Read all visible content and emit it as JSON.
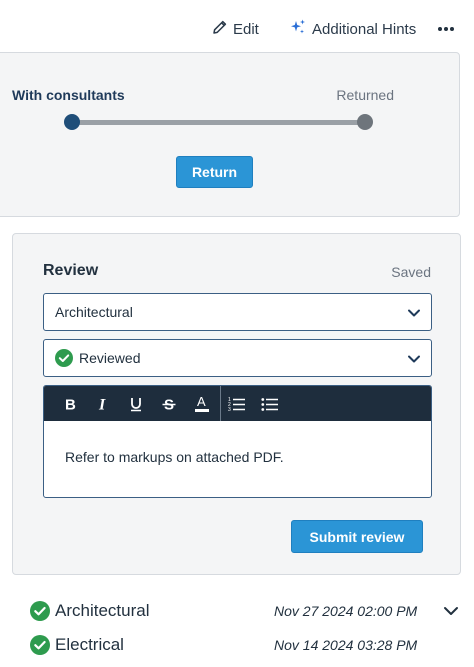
{
  "toolbar": {
    "edit_label": "Edit",
    "hints_label": "Additional Hints",
    "more_icon": "more-horizontal-icon"
  },
  "workflow": {
    "from_label": "With consultants",
    "to_label": "Returned",
    "return_label": "Return",
    "colors": {
      "start": "#1f4e79",
      "end": "#6e757c",
      "accent": "#2b95d6"
    }
  },
  "review": {
    "title": "Review",
    "status_text": "Saved",
    "discipline_value": "Architectural",
    "result_value": "Reviewed",
    "editor_tools": [
      "bold",
      "italic",
      "underline",
      "strikethrough",
      "text-color",
      "ordered-list",
      "bullet-list"
    ],
    "comment_text": "Refer to markups on attached PDF.",
    "submit_label": "Submit review"
  },
  "history": [
    {
      "label": "Architectural",
      "date": "Nov 27 2024 02:00 PM",
      "status": "approved"
    },
    {
      "label": "Electrical",
      "date": "Nov 14 2024 03:28 PM",
      "status": "approved"
    }
  ]
}
